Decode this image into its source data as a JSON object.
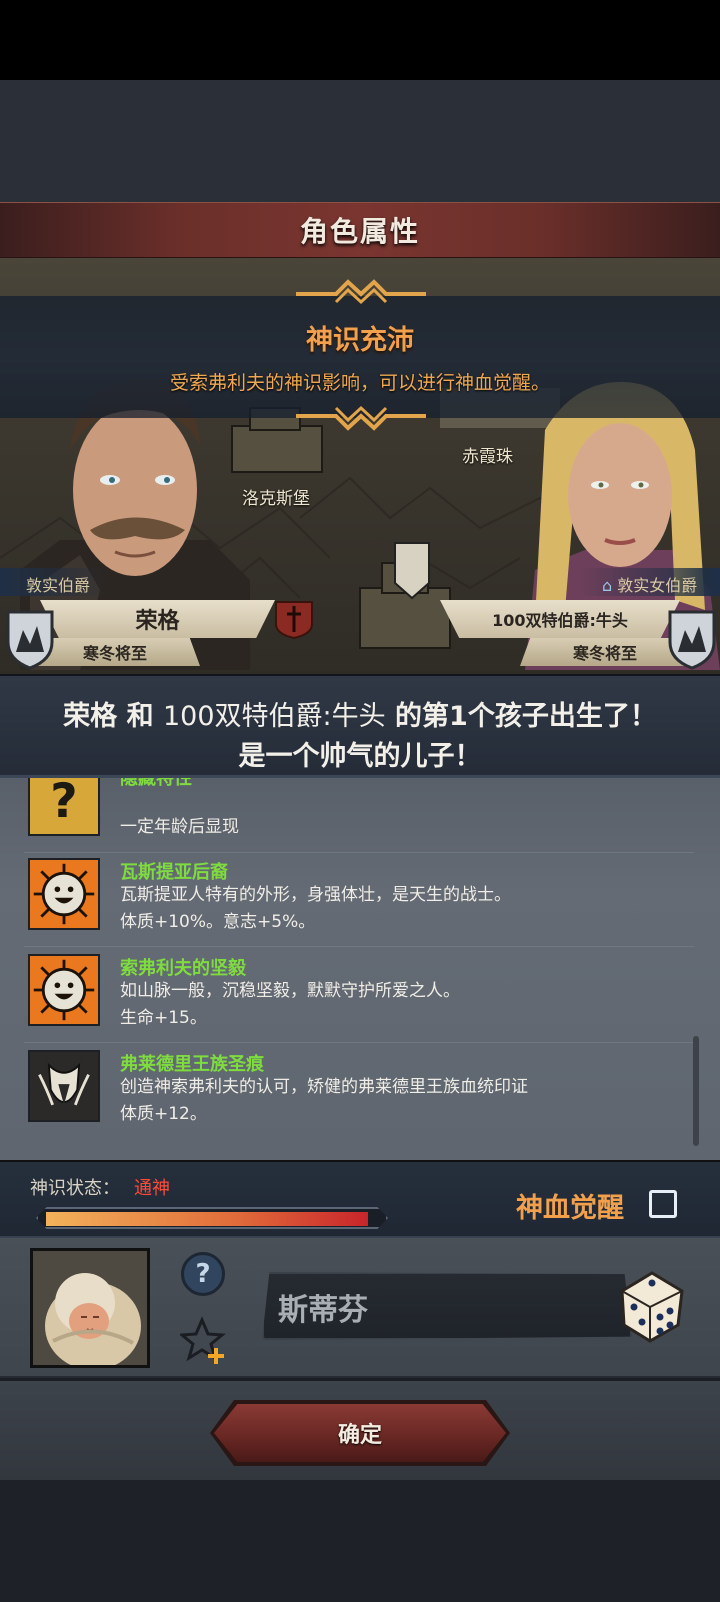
{
  "header": {
    "title": "角色属性"
  },
  "awakening": {
    "title": "神识充沛",
    "description": "受索弗利夫的神识影响，可以进行神血觉醒。"
  },
  "map": {
    "locations": [
      "洛克斯堡",
      "赤霞珠"
    ]
  },
  "father": {
    "rank": "敦实伯爵",
    "name": "荣格",
    "trait": "寒冬将至"
  },
  "mother": {
    "rank": "敦实女伯爵",
    "name": "100双特伯爵:牛头",
    "trait": "寒冬将至"
  },
  "birth": {
    "line1_father": "荣格",
    "line1_and": "和",
    "line1_mother": "100双特伯爵:牛头",
    "line1_suffix": "的第1个孩子出生了！",
    "line2": "是一个帅气的儿子！"
  },
  "traits": [
    {
      "name": "隐藏特性",
      "desc": [
        "",
        "一定年龄后显现"
      ],
      "icon": "question-icon"
    },
    {
      "name": "瓦斯提亚后裔",
      "desc": [
        "瓦斯提亚人特有的外形，身强体壮，是天生的战士。",
        "体质+10%。意志+5%。"
      ],
      "icon": "smiley-sun-icon"
    },
    {
      "name": "索弗利夫的坚毅",
      "desc": [
        "如山脉一般，沉稳坚毅，默默守护所爱之人。",
        "生命+15。"
      ],
      "icon": "smiley-sun-icon"
    },
    {
      "name": "弗莱德里王族圣痕",
      "desc": [
        "创造神索弗利夫的认可，矫健的弗莱德里王族血统印证",
        "体质+12。"
      ],
      "icon": "royal-crest-icon"
    }
  ],
  "status": {
    "label": "神识状态：",
    "value": "通神",
    "progress": 0.97,
    "awaken_label": "神血觉醒",
    "awaken_checked": false
  },
  "child": {
    "name_value": "斯蒂芬"
  },
  "footer": {
    "confirm_label": "确定"
  },
  "colors": {
    "accent_orange": "#f2a04b",
    "trait_green": "#7fdc3f",
    "status_red": "#ff4a3a"
  }
}
